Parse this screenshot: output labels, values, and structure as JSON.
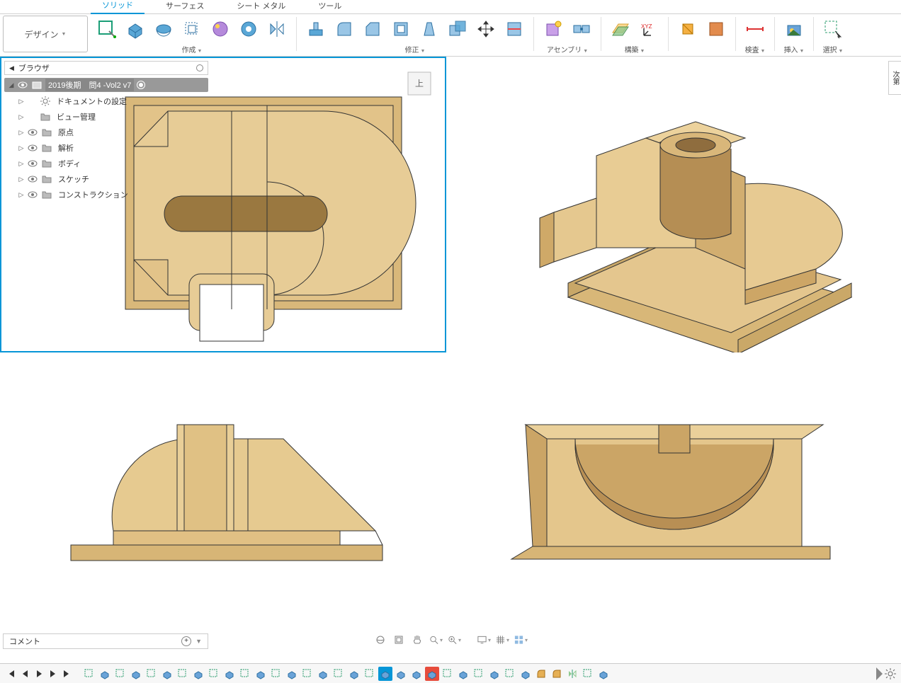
{
  "tabs": {
    "solid": "ソリッド",
    "surface": "サーフェス",
    "sheetmetal": "シート メタル",
    "tools": "ツール"
  },
  "workspace": "デザイン",
  "ribbon_groups": {
    "create": "作成",
    "modify": "修正",
    "assemble": "アセンブリ",
    "construct": "構築",
    "inspect": "検査",
    "insert": "挿入",
    "select": "選択"
  },
  "browser": {
    "title": "ブラウザ",
    "root": "2019後期　問4 -Vol2 v7",
    "items": [
      {
        "label": "ドキュメントの設定",
        "icon": "gear"
      },
      {
        "label": "ビュー管理",
        "icon": "folder"
      },
      {
        "label": "原点",
        "icon": "folder",
        "eye": true
      },
      {
        "label": "解析",
        "icon": "folder",
        "eye": true
      },
      {
        "label": "ボディ",
        "icon": "folder",
        "eye": true
      },
      {
        "label": "スケッチ",
        "icon": "folder",
        "eye": true
      },
      {
        "label": "コンストラクション",
        "icon": "folder",
        "eye": true
      }
    ]
  },
  "viewcube_face": "上",
  "comments_label": "コメント",
  "side_flyout": "次第",
  "timeline": {
    "items": [
      "sketch",
      "extrude",
      "sketch",
      "extrude",
      "sketch",
      "extrude",
      "sketch",
      "extrude",
      "sketch",
      "extrude",
      "sketch",
      "extrude",
      "sketch",
      "extrude",
      "sketch",
      "extrude",
      "sketch",
      "extrude",
      "sketch",
      "sel",
      "extrude",
      "extrude",
      "err",
      "sketch",
      "extrude",
      "sketch",
      "extrude",
      "sketch",
      "extrude",
      "fillet",
      "fillet",
      "mirror",
      "sketch",
      "extrude"
    ]
  }
}
